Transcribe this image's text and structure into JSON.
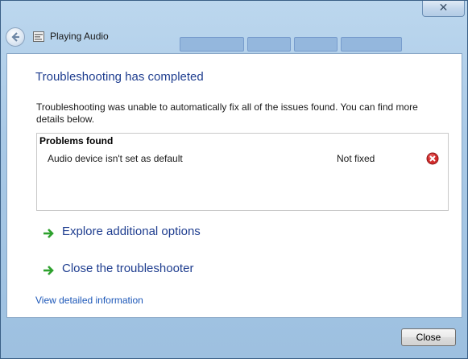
{
  "window": {
    "title": "Playing Audio",
    "close_glyph": "✕"
  },
  "main": {
    "heading": "Troubleshooting has completed",
    "description": "Troubleshooting was unable to automatically fix all of the issues found. You can find more details below.",
    "problems": {
      "header": "Problems found",
      "items": [
        {
          "name": "Audio device isn't set as default",
          "status": "Not fixed",
          "icon": "error-icon"
        }
      ]
    },
    "options": [
      {
        "label": "Explore additional options",
        "icon": "green-arrow-icon"
      },
      {
        "label": "Close the troubleshooter",
        "icon": "green-arrow-icon"
      }
    ],
    "detail_link": "View detailed information"
  },
  "footer": {
    "close_label": "Close"
  },
  "colors": {
    "heading": "#1e3d8f",
    "link": "#1c57b8",
    "arrow": "#2ea12e",
    "error": "#d22b2b"
  }
}
